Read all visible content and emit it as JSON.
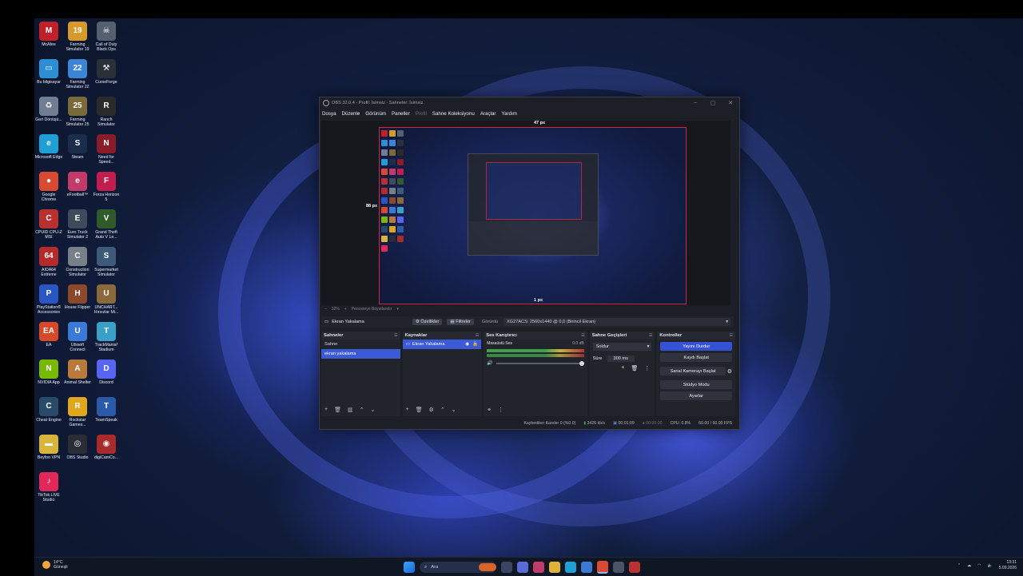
{
  "desktop": {
    "icons": [
      {
        "label": "McAfee",
        "color": "#c0202a",
        "glyph": "M"
      },
      {
        "label": "Farming Simulator 19",
        "color": "#d79a2a",
        "glyph": "19"
      },
      {
        "label": "Call of Duty Black Ops",
        "color": "#55606e",
        "glyph": "☠"
      },
      {
        "label": "Bu bilgisayar",
        "color": "#2c8fd6",
        "glyph": "▭"
      },
      {
        "label": "Farming Simulator 22",
        "color": "#3a85d8",
        "glyph": "22"
      },
      {
        "label": "CurseForge",
        "color": "#2b2f38",
        "glyph": "⚒"
      },
      {
        "label": "Geri Dönüşü...",
        "color": "#6f7e92",
        "glyph": "♻"
      },
      {
        "label": "Farming Simulator 25",
        "color": "#7a6a3a",
        "glyph": "25"
      },
      {
        "label": "Ranch Simulator",
        "color": "#2a2a2a",
        "glyph": "R"
      },
      {
        "label": "Microsoft Edge",
        "color": "#1f9fd6",
        "glyph": "e"
      },
      {
        "label": "Steam",
        "color": "#1b2d4a",
        "glyph": "S"
      },
      {
        "label": "Need for Speed...",
        "color": "#8a1c2a",
        "glyph": "N"
      },
      {
        "label": "Google Chrome",
        "color": "#d94a32",
        "glyph": "●"
      },
      {
        "label": "eFootball™",
        "color": "#c23a6a",
        "glyph": "e"
      },
      {
        "label": "Forza Horizon 5",
        "color": "#c21d4f",
        "glyph": "F"
      },
      {
        "label": "CPUID CPU-Z MSI",
        "color": "#b8312f",
        "glyph": "C"
      },
      {
        "label": "Euro Truck Simulator 2",
        "color": "#3d4b5a",
        "glyph": "E"
      },
      {
        "label": "Grand Theft Auto V Le...",
        "color": "#2f5a2a",
        "glyph": "V"
      },
      {
        "label": "AIDA64 Extreme",
        "color": "#b52a2a",
        "glyph": "64"
      },
      {
        "label": "Construction Simulator",
        "color": "#777f89",
        "glyph": "C"
      },
      {
        "label": "Supermarket Simulator",
        "color": "#3e5a7a",
        "glyph": "S"
      },
      {
        "label": "PlayStation® Accessories",
        "color": "#2a56c4",
        "glyph": "P"
      },
      {
        "label": "House Flipper",
        "color": "#8a4a2a",
        "glyph": "H"
      },
      {
        "label": "UNCHART... Hırsızlar Mi...",
        "color": "#8a6a3a",
        "glyph": "U"
      },
      {
        "label": "EA",
        "color": "#d8482a",
        "glyph": "EA"
      },
      {
        "label": "Ubisoft Connect",
        "color": "#3a7ad6",
        "glyph": "U"
      },
      {
        "label": "TrackMania² Stadium",
        "color": "#3aa0c8",
        "glyph": "T"
      },
      {
        "label": "NVIDIA App",
        "color": "#76b900",
        "glyph": "N"
      },
      {
        "label": "Animal Shelter",
        "color": "#b8793a",
        "glyph": "A"
      },
      {
        "label": "Discord",
        "color": "#5865f2",
        "glyph": "D"
      },
      {
        "label": "Cheat Engine",
        "color": "#2a4a6a",
        "glyph": "C"
      },
      {
        "label": "Rockstar Games...",
        "color": "#e0a71c",
        "glyph": "R"
      },
      {
        "label": "TeamSpeak",
        "color": "#2a5aa8",
        "glyph": "T"
      },
      {
        "label": "Beyfoo VPN",
        "color": "#d8b43a",
        "glyph": "▬"
      },
      {
        "label": "OBS Studio",
        "color": "#2a2d36",
        "glyph": "◎"
      },
      {
        "label": "digiCamCo...",
        "color": "#a82a2a",
        "glyph": "◉"
      },
      {
        "label": "TikTok LIVE Studio",
        "color": "#e0285a",
        "glyph": "♪"
      }
    ]
  },
  "obs": {
    "title": "OBS 32.0.4 - Profil: İsimsiz - Sahneler: İsimsiz",
    "menu": [
      "Dosya",
      "Düzenle",
      "Görünüm",
      "Paneller",
      "Profil",
      "Sahne Koleksiyonu",
      "Araçlar",
      "Yardım"
    ],
    "preview": {
      "top_label": "47 px",
      "left_label": "88 px",
      "bottom_label": "1 px"
    },
    "zoom": {
      "percent": "32%",
      "fit_label": "Pencereye Boyutlandır"
    },
    "source_bar": {
      "source_name": "Ekran Yakalama",
      "properties": "Özellikler",
      "filters": "Filtreler",
      "display_label": "Görüntü",
      "display_value": "XG27ACS: 2560x1440 @ 0,0 (Birincil Ekran)"
    },
    "scenes": {
      "title": "Sahneler",
      "items": [
        "Sahne",
        "ekran yakalama"
      ],
      "selected": 1
    },
    "sources": {
      "title": "Kaynaklar",
      "items": [
        "Ekran Yakalama"
      ]
    },
    "mixer": {
      "title": "Ses Karıştırıcı",
      "channel": "Masaüstü Ses",
      "level": "0.0 dB"
    },
    "transitions": {
      "title": "Sahne Geçişleri",
      "type": "Soldur",
      "duration_label": "Süre",
      "duration_value": "300 ms"
    },
    "controls": {
      "title": "Kontroller",
      "buttons": [
        "Yayını Durdur",
        "Kaydı Başlat",
        "Sanal Kamerayı Başlat",
        "Stüdyo Modu",
        "Ayarlar"
      ]
    },
    "status": {
      "dropped": "Kaybedilen Kareler 0 (%0.0)",
      "bitrate": "3426 kb/s",
      "stream_time": "00:01:09",
      "rec_time": "00:00:00",
      "cpu": "CPU: 0.8%",
      "fps": "60.00 / 60.00 FPS"
    }
  },
  "taskbar": {
    "weather_temp": "14°C",
    "weather_desc": "Güneşli",
    "search_placeholder": "Ara",
    "time": "13:31",
    "date": "5.09.2026"
  }
}
